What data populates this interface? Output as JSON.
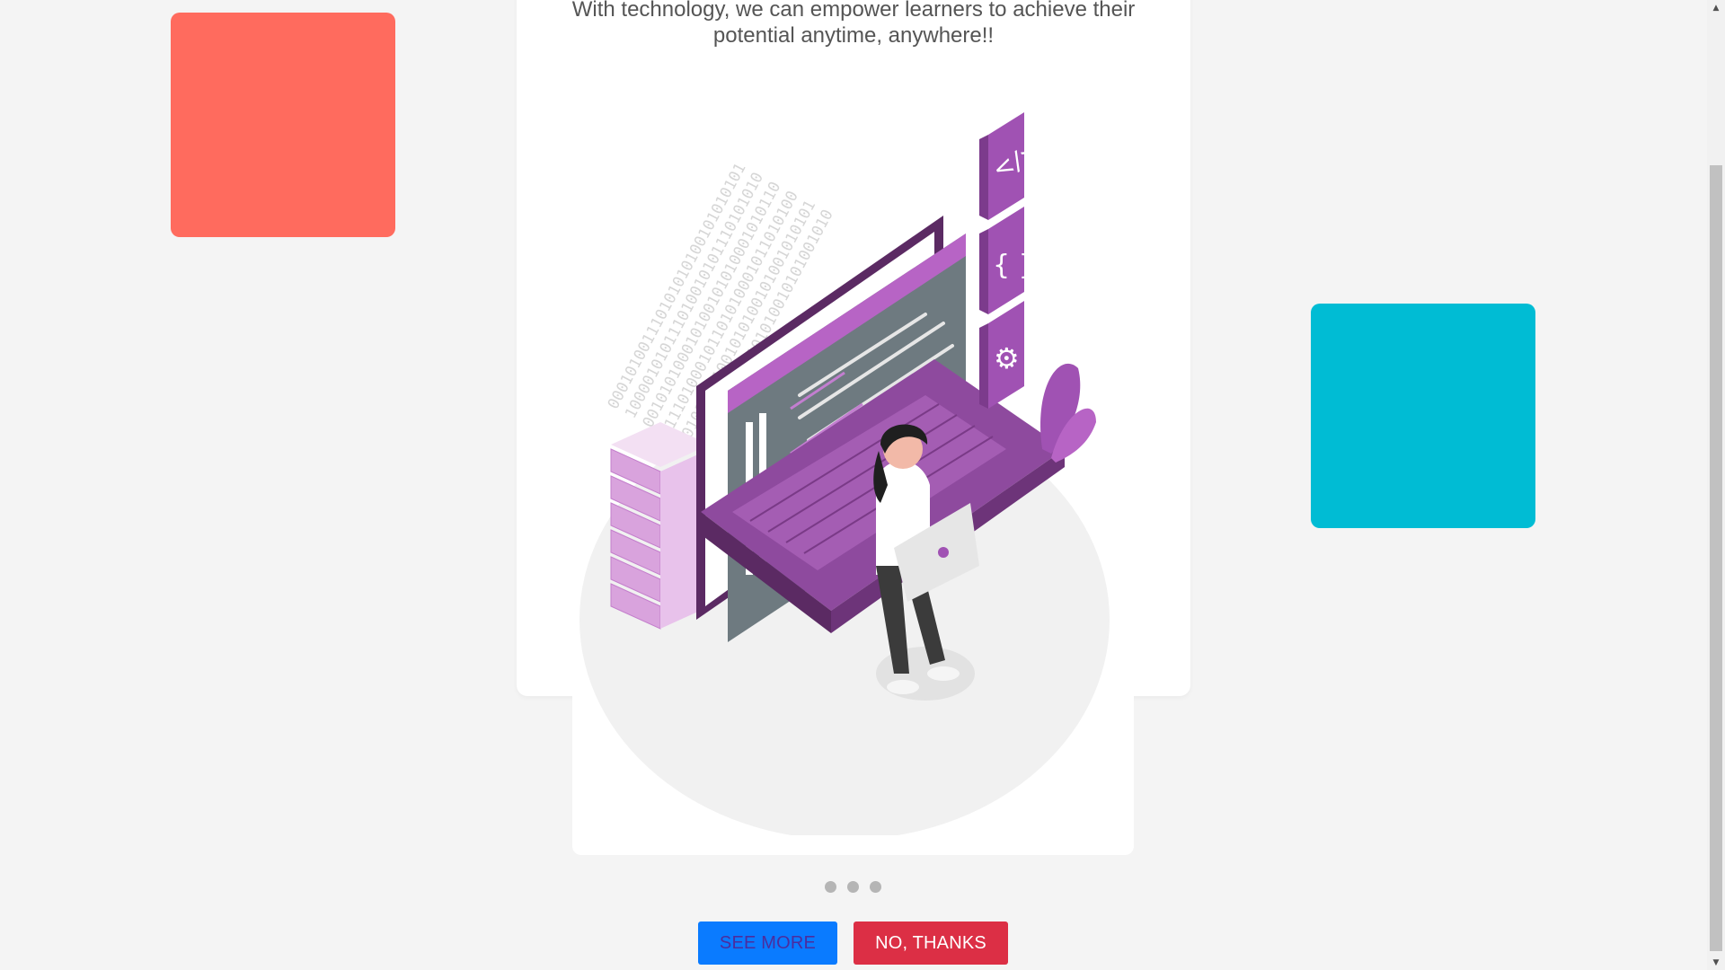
{
  "card": {
    "tagline": "With technology, we can empower learners to achieve their potential anytime, anywhere!!"
  },
  "carousel": {
    "dot_count": 3,
    "active_index": 0
  },
  "actions": {
    "see_more_label": "SEE MORE",
    "no_thanks_label": "NO, THANKS"
  },
  "colors": {
    "background": "#f4f4f4",
    "deco_red": "#ff6b5e",
    "deco_cyan": "#00bcd4",
    "see_more_bg": "#0a7bff",
    "see_more_text": "#4b2d9e",
    "no_thanks_bg": "#dc2f45",
    "illustration_purple": "#8e4a9e"
  },
  "icons": {
    "illustration": "developer-laptop-illustration",
    "scroll_up": "scroll-up-arrow-icon",
    "scroll_down": "scroll-down-arrow-icon"
  }
}
